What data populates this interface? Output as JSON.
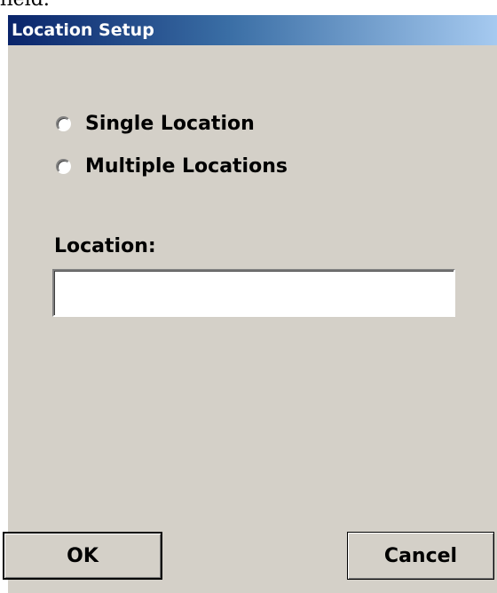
{
  "top_fragment": "field.",
  "dialog": {
    "title": "Location Setup",
    "options": [
      {
        "label": "Single Location",
        "selected": false
      },
      {
        "label": "Multiple Locations",
        "selected": false
      }
    ],
    "location_label": "Location:",
    "location_value": "",
    "ok_label": "OK",
    "cancel_label": "Cancel"
  },
  "colors": {
    "title_gradient_start": "#0a246a",
    "title_gradient_end": "#a6caf0",
    "dialog_background": "#d4d0c8"
  }
}
